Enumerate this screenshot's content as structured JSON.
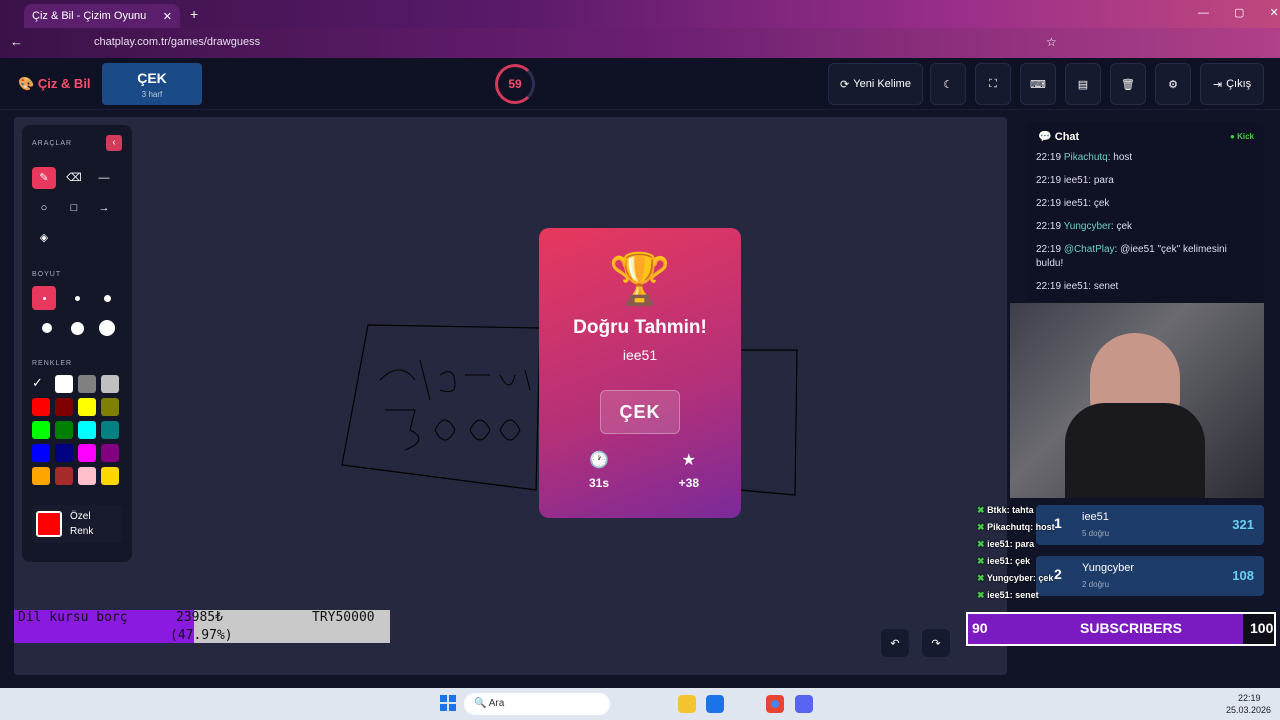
{
  "browser": {
    "tab_title": "Çiz & Bil - Çizim Oyunu",
    "url": "chatplay.com.tr/games/drawguess"
  },
  "header": {
    "logo": "Çiz & Bil",
    "word": "ÇEK",
    "word_hint": "3 harf",
    "timer": "59",
    "new_word": "Yeni Kelime",
    "exit": "Çıkış"
  },
  "tools": {
    "title": "ARAÇLAR",
    "size_title": "BOYUT",
    "colors_title": "RENKLER",
    "custom_line1": "Özel",
    "custom_line2": "Renk",
    "palette": [
      "#000000",
      "#ffffff",
      "#808080",
      "#c0c0c0",
      "#ff0000",
      "#800000",
      "#ffff00",
      "#808000",
      "#00ff00",
      "#008000",
      "#00ffff",
      "#008080",
      "#0000ff",
      "#000080",
      "#ff00ff",
      "#800080",
      "#ffa500",
      "#a52a2a",
      "#ffc0cb",
      "#ffd700"
    ],
    "custom_color": "#ff0000"
  },
  "modal": {
    "title": "Doğru Tahmin!",
    "player": "iee51",
    "word": "ÇEK",
    "time": "31s",
    "points": "+38"
  },
  "chat": {
    "title": "Chat",
    "badge": "Kick",
    "messages": [
      {
        "time": "22:19",
        "name": "Pikachutq",
        "text": ": host",
        "colored": true
      },
      {
        "time": "22:19",
        "name": "iee51",
        "text": ": para",
        "colored": false
      },
      {
        "time": "22:19",
        "name": "iee51",
        "text": ": çek",
        "colored": false
      },
      {
        "time": "22:19",
        "name": "Yungcyber",
        "text": ": çek",
        "colored": true
      },
      {
        "time": "22:19",
        "name": "@ChatPlay",
        "text": ": @iee51 \"çek\" kelimesini buldu!",
        "colored": true
      },
      {
        "time": "22:19",
        "name": "iee51",
        "text": ": senet",
        "colored": false
      }
    ]
  },
  "leaderboard": [
    {
      "rank": "1",
      "name": "iee51",
      "sub": "5 doğru",
      "score": "321"
    },
    {
      "rank": "2",
      "name": "Yungcyber",
      "sub": "2 doğru",
      "score": "108"
    }
  ],
  "overlay_chat": [
    {
      "name": "Btkk",
      "text": ": tahta"
    },
    {
      "name": "Pikachutq",
      "text": ": host"
    },
    {
      "name": "iee51",
      "text": ": para"
    },
    {
      "name": "iee51",
      "text": ": çek"
    },
    {
      "name": "Yungcyber",
      "text": ": çek"
    },
    {
      "name": "iee51",
      "text": ": senet"
    }
  ],
  "goal": {
    "label": "Dil kursu borç",
    "current": "23985₺",
    "percent": "(47.97%)",
    "target": "TRY50000",
    "progress": 0.4797
  },
  "subs": {
    "current": "90",
    "label": "SUBSCRIBERS",
    "goal": "100",
    "progress": 0.9
  },
  "taskbar": {
    "search": "Ara",
    "time": "22:19",
    "date": "25.03.2026"
  }
}
